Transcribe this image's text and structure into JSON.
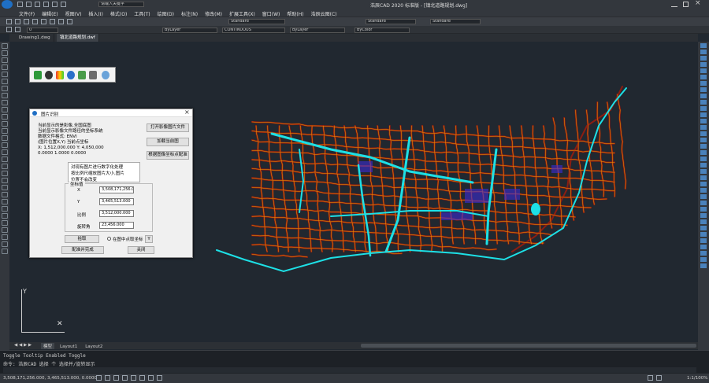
{
  "window": {
    "app_title": "浩辰CAD 2020 标准版",
    "doc_title": "[镇北道路规划.dwg]"
  },
  "menu": [
    "文件(F)",
    "编辑(E)",
    "视图(V)",
    "插入(I)",
    "格式(O)",
    "工具(T)",
    "绘图(D)",
    "标注(N)",
    "修改(M)",
    "扩展工具(X)",
    "窗口(W)",
    "帮助(H)",
    "浩辰云图(C)"
  ],
  "quick_search": "请输入关键字",
  "ribbon_styles": [
    "Standard",
    "Standard",
    "Standard"
  ],
  "prop": {
    "layer": "0",
    "color": "ByLayer",
    "linetype": "CONTINUOUS",
    "lineweight": "ByLayer",
    "plotstyle": "ByColor"
  },
  "doc_tabs": [
    "Drawing1.dwg",
    "镇北道路规划.dwf"
  ],
  "dialog": {
    "title": "图片识别",
    "info_lines": [
      "当前显示的是影像,全国底图",
      "当前显示影像文件路径的坐标系统",
      "数据文件格式: ENVI",
      "(图片位置X,Y) 当前点坐标",
      "X: 1,512,000.000 Y: 4,050,000",
      "0.0000 1.0000 0.0000"
    ],
    "btn_open": "打开影像图片文件",
    "btn_load": "加载当前图",
    "btn_align": "根据图像坐标点配准",
    "check_text_1": "对现有图片进行数字化处理",
    "check_text_2": "按比例尺缩放图片大小,图片",
    "check_text_3": "位置不会改变",
    "group_label": "坐标值",
    "fields": [
      {
        "label": "X",
        "value": "3,508,171,256.000"
      },
      {
        "label": "Y",
        "value": "3,465,513.000"
      },
      {
        "label": "比例",
        "value": "3,512,000.000"
      },
      {
        "label": "旋转角",
        "value": "23,456.000"
      }
    ],
    "btn_pick": "拾取",
    "radio_text": "在图中点取坐标",
    "btn_y": "Y",
    "btn_confirm": "配准并完成",
    "btn_close": "关闭"
  },
  "float_tools": [
    "play-icon",
    "disc-icon",
    "color-icon",
    "globe-icon",
    "map-icon",
    "image-icon",
    "gear-icon"
  ],
  "axis": {
    "y": "Y"
  },
  "layout_tabs": [
    "模型",
    "Layout1",
    "Layout2"
  ],
  "command": {
    "line1": "Toggle Tooltip Enabled Toggle",
    "line2": "命令: 浩辰CAD 选择 个 选择并/旋转显示"
  },
  "status": {
    "coords": "3,508,171,256.000, 3,465,513.000, 0.0000",
    "right": "1:1/100%"
  },
  "colors": {
    "canvas": "#212830",
    "road_outline": "#8c1d12",
    "road_center": "#f0a000",
    "river": "#1de0e6",
    "blue_area": "#3a2bd4"
  }
}
